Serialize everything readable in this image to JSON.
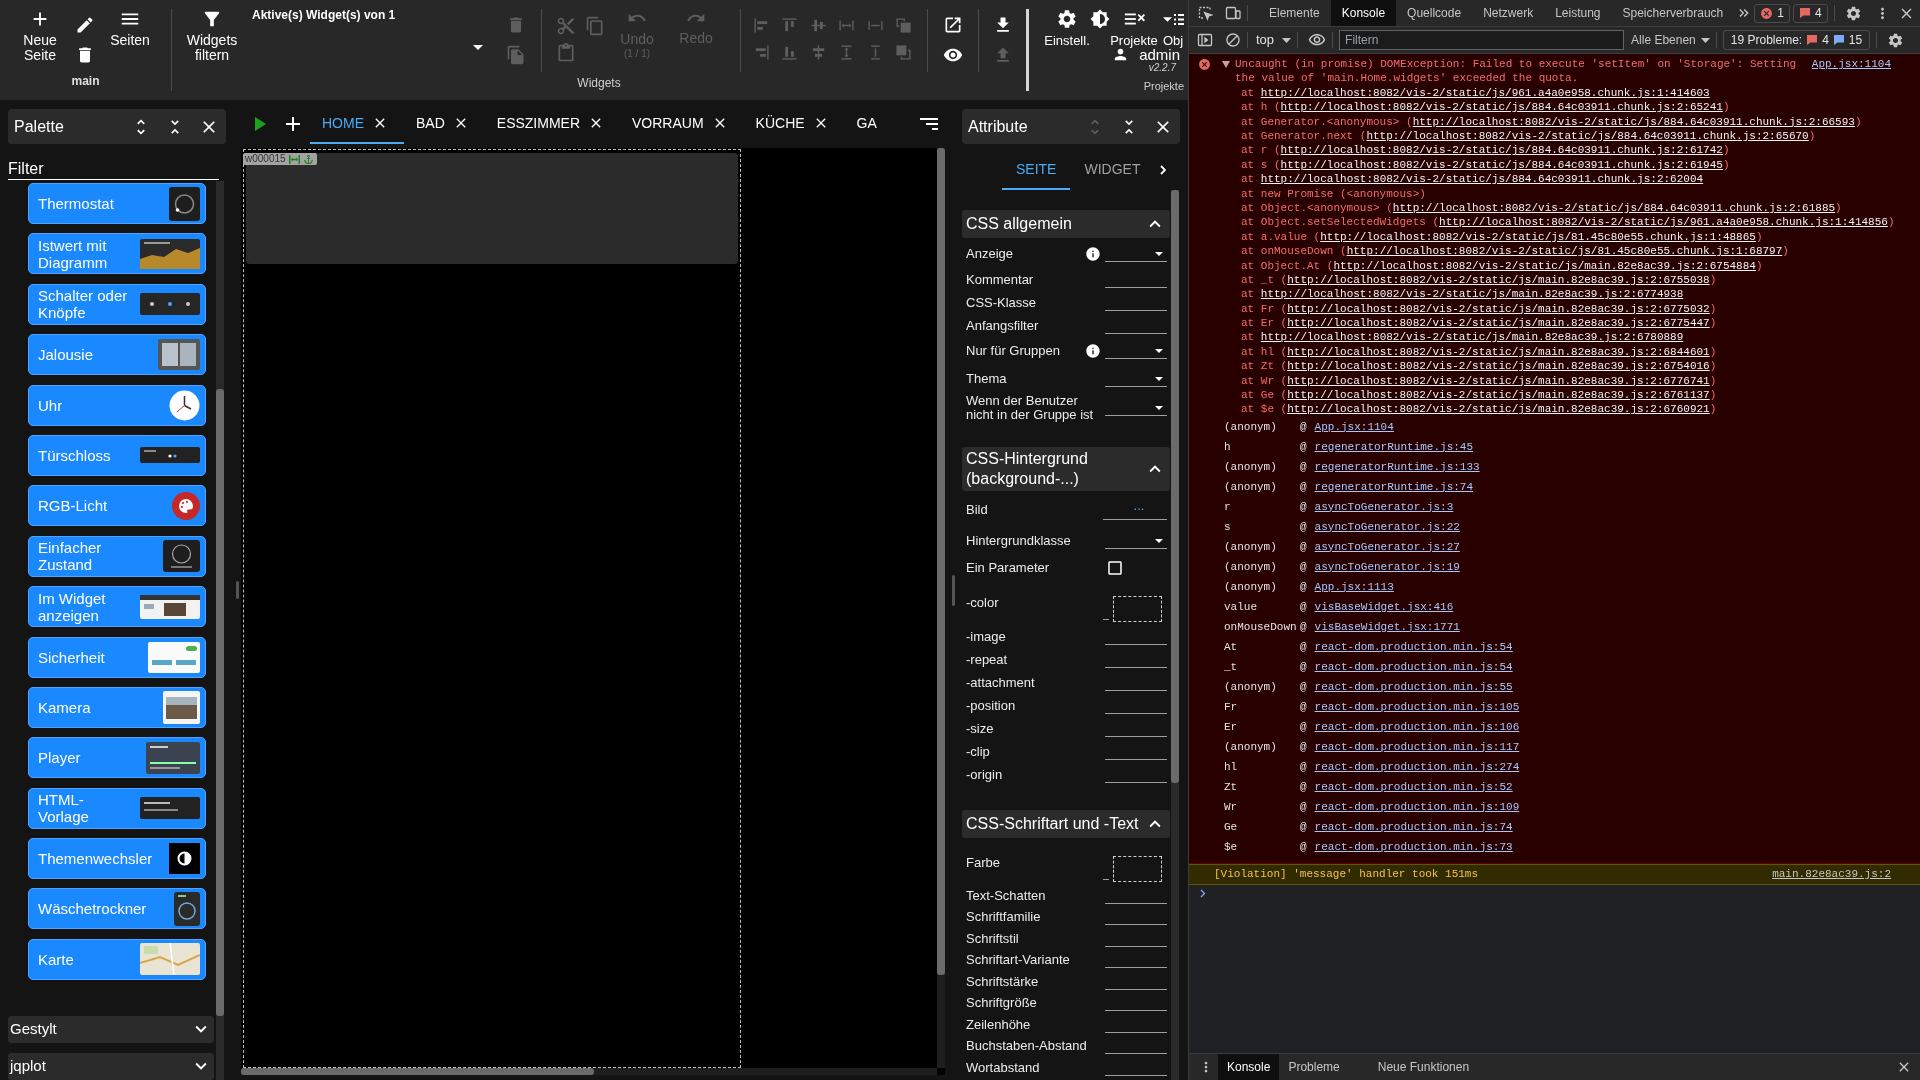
{
  "toolbar": {
    "page_group": {
      "buttons": [
        {
          "label": "Neue Seite",
          "disabled": false
        },
        {
          "label": "Seiten",
          "disabled": false
        }
      ],
      "page_actions": [
        {
          "disabled": false
        },
        {
          "disabled": false
        }
      ],
      "caption": "main"
    },
    "widget_group": {
      "filter": {
        "label": "Widgets filtern",
        "disabled": false
      },
      "active_select": {
        "label": "Aktive(s) Widget(s) von 1"
      },
      "widget_actions": [
        {
          "disabled": true
        },
        {
          "disabled": true
        }
      ],
      "clipboard": [
        {
          "disabled": true
        },
        {
          "disabled": true
        },
        {
          "disabled": true
        }
      ],
      "undo": {
        "label": "Undo",
        "counter": "(1 / 1)",
        "disabled": true
      },
      "redo": {
        "label": "Redo",
        "disabled": true
      },
      "alignment": [
        {
          "disabled": true
        },
        {
          "disabled": true
        },
        {
          "disabled": true
        },
        {
          "disabled": true
        },
        {
          "disabled": true
        },
        {
          "disabled": true
        },
        {
          "disabled": true
        },
        {
          "disabled": true
        },
        {
          "disabled": true
        },
        {
          "disabled": true
        },
        {
          "disabled": true
        },
        {
          "disabled": true
        }
      ],
      "view_actions": [
        {
          "disabled": false
        },
        {
          "disabled": false
        }
      ],
      "transfer": [
        {
          "disabled": false
        },
        {
          "disabled": true
        }
      ],
      "caption": "Widgets"
    },
    "project_group": {
      "buttons": [
        {
          "label": "Einstell."
        },
        {
          "label": "Projekte"
        },
        {
          "label": "Obj"
        }
      ],
      "user": "admin",
      "version": "v2.2.7",
      "caption": "Projekte"
    }
  },
  "palette": {
    "title": "Palette",
    "filter": {
      "placeholder": "Filter"
    },
    "items": [
      {
        "label": "Thermostat"
      },
      {
        "label": "Istwert mit Diagramm"
      },
      {
        "label": "Schalter oder Knöpfe"
      },
      {
        "label": "Jalousie"
      },
      {
        "label": "Uhr"
      },
      {
        "label": "Türschloss"
      },
      {
        "label": "RGB-Licht"
      },
      {
        "label": "Einfacher Zustand"
      },
      {
        "label": "Im Widget anzeigen"
      },
      {
        "label": "Sicherheit"
      },
      {
        "label": "Kamera"
      },
      {
        "label": "Player"
      },
      {
        "label": "HTML-Vorlage"
      },
      {
        "label": "Themenwechsler"
      },
      {
        "label": "Wäschetrockner"
      },
      {
        "label": "Karte"
      }
    ],
    "groups": [
      {
        "label": "Gestylt",
        "expanded": false
      },
      {
        "label": "jqplot",
        "expanded": false
      }
    ]
  },
  "editor": {
    "tabs": [
      {
        "label": "HOME",
        "selected": true,
        "closable": true
      },
      {
        "label": "BAD",
        "selected": false,
        "closable": true
      },
      {
        "label": "ESSZIMMER",
        "selected": false,
        "closable": true
      },
      {
        "label": "VORRAUM",
        "selected": false,
        "closable": true
      },
      {
        "label": "KÜCHE",
        "selected": false,
        "closable": true
      },
      {
        "label": "GA",
        "selected": false,
        "closable": false
      }
    ],
    "widget": {
      "id": "w000015"
    }
  },
  "attributes": {
    "title": "Attribute",
    "tabs": [
      {
        "label": "SEITE",
        "selected": true
      },
      {
        "label": "WIDGET",
        "selected": false
      }
    ],
    "sections": [
      {
        "title": "CSS allgemein",
        "expanded": true,
        "fields": [
          {
            "label": "Anzeige",
            "kind": "select",
            "info": true
          },
          {
            "label": "Kommentar",
            "kind": "text"
          },
          {
            "label": "CSS-Klasse",
            "kind": "text"
          },
          {
            "label": "Anfangsfilter",
            "kind": "text"
          },
          {
            "label": "Nur für Gruppen",
            "kind": "select",
            "info": true
          },
          {
            "label": "Thema",
            "kind": "select"
          },
          {
            "label": "Wenn der Benutzer nicht in der Gruppe ist",
            "kind": "select"
          }
        ]
      },
      {
        "title": "CSS-Hintergrund (background-...)",
        "expanded": true,
        "fields": [
          {
            "label": "Bild",
            "kind": "image",
            "button": "..."
          },
          {
            "label": "Hintergrundklasse",
            "kind": "select"
          },
          {
            "label": "Ein Parameter",
            "kind": "checkbox",
            "checked": false
          },
          {
            "label": "-color",
            "kind": "color"
          },
          {
            "label": "-image",
            "kind": "text"
          },
          {
            "label": "-repeat",
            "kind": "text"
          },
          {
            "label": "-attachment",
            "kind": "text"
          },
          {
            "label": "-position",
            "kind": "text"
          },
          {
            "label": "-size",
            "kind": "text"
          },
          {
            "label": "-clip",
            "kind": "text"
          },
          {
            "label": "-origin",
            "kind": "text"
          }
        ]
      },
      {
        "title": "CSS-Schriftart und -Text",
        "expanded": true,
        "fields": [
          {
            "label": "Farbe",
            "kind": "color"
          },
          {
            "label": "Text-Schatten",
            "kind": "text"
          },
          {
            "label": "Schriftfamilie",
            "kind": "text"
          },
          {
            "label": "Schriftstil",
            "kind": "text"
          },
          {
            "label": "Schriftart-Variante",
            "kind": "text"
          },
          {
            "label": "Schriftstärke",
            "kind": "text"
          },
          {
            "label": "Schriftgröße",
            "kind": "text"
          },
          {
            "label": "Zeilenhöhe",
            "kind": "text"
          },
          {
            "label": "Buchstaben-Abstand",
            "kind": "text"
          },
          {
            "label": "Wortabstand",
            "kind": "text"
          }
        ]
      }
    ]
  },
  "devtools": {
    "tabs": [
      {
        "label": "Elemente",
        "selected": false
      },
      {
        "label": "Konsole",
        "selected": true
      },
      {
        "label": "Quellcode",
        "selected": false
      },
      {
        "label": "Netzwerk",
        "selected": false
      },
      {
        "label": "Leistung",
        "selected": false
      },
      {
        "label": "Speicherverbrauch",
        "selected": false
      }
    ],
    "error_count": "1",
    "issue_count": "4",
    "console_toolbar": {
      "context": "top",
      "filter": {
        "placeholder": "Filtern"
      },
      "levels": "Alle Ebenen",
      "issues": {
        "label": "19 Probleme:",
        "errors": "4",
        "infos": "15"
      }
    },
    "messages": [
      {
        "kind": "error",
        "expanded": true,
        "text": "Uncaught (in promise) DOMException: Failed to execute 'setItem' on 'Storage': Setting the value of 'main.Home.widgets' exceeded the quota.",
        "source": "App.jsx:1104",
        "stack": [
          {
            "text": "at ",
            "link": "http://localhost:8082/vis-2/static/js/961.a4a0e958.chunk.js:1:414603"
          },
          {
            "text": "at h (",
            "link": "http://localhost:8082/vis-2/static/js/884.64c03911.chunk.js:2:65241",
            "after": ")"
          },
          {
            "text": "at Generator.<anonymous> (",
            "link": "http://localhost:8082/vis-2/static/js/884.64c03911.chunk.js:2:66593",
            "after": ")"
          },
          {
            "text": "at Generator.next (",
            "link": "http://localhost:8082/vis-2/static/js/884.64c03911.chunk.js:2:65670",
            "after": ")"
          },
          {
            "text": "at r (",
            "link": "http://localhost:8082/vis-2/static/js/884.64c03911.chunk.js:2:61742",
            "after": ")"
          },
          {
            "text": "at s (",
            "link": "http://localhost:8082/vis-2/static/js/884.64c03911.chunk.js:2:61945",
            "after": ")"
          },
          {
            "text": "at ",
            "link": "http://localhost:8082/vis-2/static/js/884.64c03911.chunk.js:2:62004"
          },
          {
            "text": "at new Promise (<anonymous>)"
          },
          {
            "text": "at Object.<anonymous> (",
            "link": "http://localhost:8082/vis-2/static/js/884.64c03911.chunk.js:2:61885",
            "after": ")"
          },
          {
            "text": "at Object.setSelectedWidgets (",
            "link": "http://localhost:8082/vis-2/static/js/961.a4a0e958.chunk.js:1:414856",
            "after": ")"
          },
          {
            "text": "at a.value (",
            "link": "http://localhost:8082/vis-2/static/js/81.45c80e55.chunk.js:1:48865",
            "after": ")"
          },
          {
            "text": "at onMouseDown (",
            "link": "http://localhost:8082/vis-2/static/js/81.45c80e55.chunk.js:1:68797",
            "after": ")"
          },
          {
            "text": "at Object.At (",
            "link": "http://localhost:8082/vis-2/static/js/main.82e8ac39.js:2:6754884",
            "after": ")"
          },
          {
            "text": "at _t (",
            "link": "http://localhost:8082/vis-2/static/js/main.82e8ac39.js:2:6755038",
            "after": ")"
          },
          {
            "text": "at ",
            "link": "http://localhost:8082/vis-2/static/js/main.82e8ac39.js:2:6774938"
          },
          {
            "text": "at Fr (",
            "link": "http://localhost:8082/vis-2/static/js/main.82e8ac39.js:2:6775032",
            "after": ")"
          },
          {
            "text": "at Er (",
            "link": "http://localhost:8082/vis-2/static/js/main.82e8ac39.js:2:6775447",
            "after": ")"
          },
          {
            "text": "at ",
            "link": "http://localhost:8082/vis-2/static/js/main.82e8ac39.js:2:6780889"
          },
          {
            "text": "at hl (",
            "link": "http://localhost:8082/vis-2/static/js/main.82e8ac39.js:2:6844601",
            "after": ")"
          },
          {
            "text": "at Zt (",
            "link": "http://localhost:8082/vis-2/static/js/main.82e8ac39.js:2:6754016",
            "after": ")"
          },
          {
            "text": "at Wr (",
            "link": "http://localhost:8082/vis-2/static/js/main.82e8ac39.js:2:6776741",
            "after": ")"
          },
          {
            "text": "at Ge (",
            "link": "http://localhost:8082/vis-2/static/js/main.82e8ac39.js:2:6761137",
            "after": ")"
          },
          {
            "text": "at $e (",
            "link": "http://localhost:8082/vis-2/static/js/main.82e8ac39.js:2:6760921",
            "after": ")"
          }
        ],
        "async_stack": [
          {
            "function": "(anonym)",
            "at": "@",
            "source": "App.jsx:1104"
          },
          {
            "function": "h",
            "at": "@",
            "source": "regeneratorRuntime.js:45"
          },
          {
            "function": "(anonym)",
            "at": "@",
            "source": "regeneratorRuntime.js:133"
          },
          {
            "function": "(anonym)",
            "at": "@",
            "source": "regeneratorRuntime.js:74"
          },
          {
            "function": "r",
            "at": "@",
            "source": "asyncToGenerator.js:3"
          },
          {
            "function": "s",
            "at": "@",
            "source": "asyncToGenerator.js:22"
          },
          {
            "function": "(anonym)",
            "at": "@",
            "source": "asyncToGenerator.js:27"
          },
          {
            "function": "(anonym)",
            "at": "@",
            "source": "asyncToGenerator.js:19"
          },
          {
            "function": "(anonym)",
            "at": "@",
            "source": "App.jsx:1113"
          },
          {
            "function": "value",
            "at": "@",
            "source": "visBaseWidget.jsx:416"
          },
          {
            "function": "onMouseDown",
            "at": "@",
            "source": "visBaseWidget.jsx:1771"
          },
          {
            "function": "At",
            "at": "@",
            "source": "react-dom.production.min.js:54"
          },
          {
            "function": "_t",
            "at": "@",
            "source": "react-dom.production.min.js:54"
          },
          {
            "function": "(anonym)",
            "at": "@",
            "source": "react-dom.production.min.js:55"
          },
          {
            "function": "Fr",
            "at": "@",
            "source": "react-dom.production.min.js:105"
          },
          {
            "function": "Er",
            "at": "@",
            "source": "react-dom.production.min.js:106"
          },
          {
            "function": "(anonym)",
            "at": "@",
            "source": "react-dom.production.min.js:117"
          },
          {
            "function": "hl",
            "at": "@",
            "source": "react-dom.production.min.js:274"
          },
          {
            "function": "Zt",
            "at": "@",
            "source": "react-dom.production.min.js:52"
          },
          {
            "function": "Wr",
            "at": "@",
            "source": "react-dom.production.min.js:109"
          },
          {
            "function": "Ge",
            "at": "@",
            "source": "react-dom.production.min.js:74"
          },
          {
            "function": "$e",
            "at": "@",
            "source": "react-dom.production.min.js:73"
          }
        ]
      },
      {
        "kind": "violation",
        "text": "[Violation] 'message' handler took 151ms",
        "source": "main.82e8ac39.js:2"
      }
    ],
    "drawer_tabs": [
      {
        "label": "Konsole",
        "selected": true
      },
      {
        "label": "Probleme",
        "selected": false
      },
      {
        "label": "Neue Funktionen",
        "selected": false
      }
    ]
  }
}
